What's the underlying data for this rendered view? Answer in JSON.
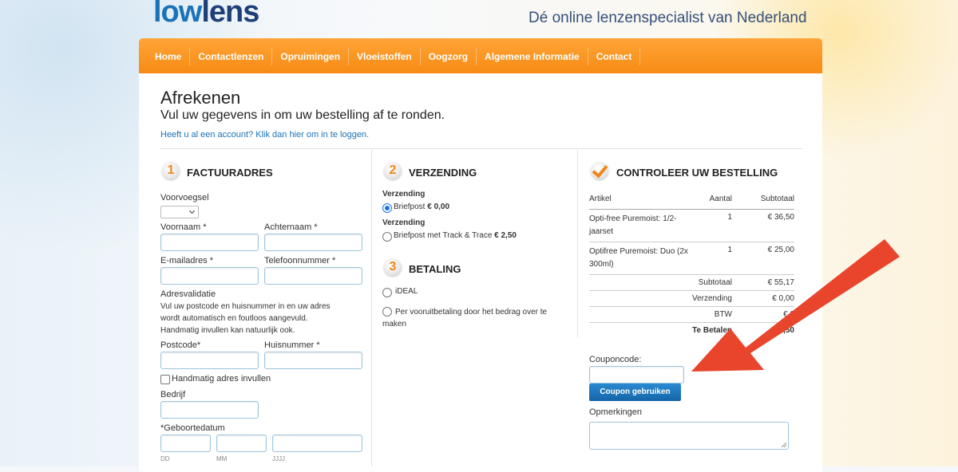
{
  "header": {
    "logo_part1": "low",
    "logo_part2": "lens",
    "tagline": "Dé online lenzenspecialist van Nederland"
  },
  "nav": {
    "items": [
      "Home",
      "Contactlenzen",
      "Opruimingen",
      "Vloeistoffen",
      "Oogzorg",
      "Algemene Informatie",
      "Contact"
    ]
  },
  "page": {
    "title": "Afrekenen",
    "subtitle": "Vul uw gegevens in om uw bestelling af te ronden.",
    "login_link": "Heeft u al een account? Klik dan hier om in te loggen."
  },
  "billing": {
    "step": "1",
    "title": "FACTUURADRES",
    "prefix_label": "Voorvoegsel",
    "firstname_label": "Voornaam *",
    "lastname_label": "Achternaam *",
    "email_label": "E-mailadres *",
    "phone_label": "Telefoonnummer *",
    "address_validation_label": "Adresvalidatie",
    "address_validation_help": "Vul uw postcode en huisnummer in en uw adres wordt automatisch en foutloos aangevuld. Handmatig invullen kan natuurlijk ook.",
    "postcode_label": "Postcode*",
    "housenumber_label": "Huisnummer *",
    "manual_address_label": "Handmatig adres invullen",
    "company_label": "Bedrijf",
    "birthdate_label": "*Geboortedatum",
    "dd": "DD",
    "mm": "MM",
    "yyyy": "JJJJ"
  },
  "shipping": {
    "step": "2",
    "title": "VERZENDING",
    "option1_heading": "Verzending",
    "option1_label": "Briefpost",
    "option1_price": "€ 0,00",
    "option2_heading": "Verzending",
    "option2_label": "Briefpost met Track & Trace",
    "option2_price": "€ 2,50"
  },
  "payment": {
    "step": "3",
    "title": "BETALING",
    "option1": "iDEAL",
    "option2": "Per vooruitbetaling door het bedrag over te maken"
  },
  "review": {
    "title": "CONTROLEER UW BESTELLING",
    "col_article": "Artikel",
    "col_qty": "Aantal",
    "col_subtotal": "Subtotaal",
    "rows": [
      {
        "article": "Opti-free Puremoist: 1/2-jaarset",
        "qty": "1",
        "subtotal": "€ 36,50"
      },
      {
        "article": "Optifree Puremoist: Duo (2x 300ml)",
        "qty": "1",
        "subtotal": "€ 25,00"
      }
    ],
    "subtotal_label": "Subtotaal",
    "subtotal_value": "€ 55,17",
    "shipping_label": "Verzending",
    "shipping_value": "€ 0,00",
    "vat_label": "BTW",
    "vat_value": "€ 6",
    "total_label": "Te Betalen",
    "total_value": "€1,50",
    "coupon_label": "Couponcode:",
    "coupon_button": "Coupon gebruiken",
    "remarks_label": "Opmerkingen"
  },
  "colors": {
    "nav_orange": "#f68a12",
    "link_blue": "#1a72b8",
    "button_blue": "#1565a8",
    "arrow_red": "#e8452c"
  }
}
